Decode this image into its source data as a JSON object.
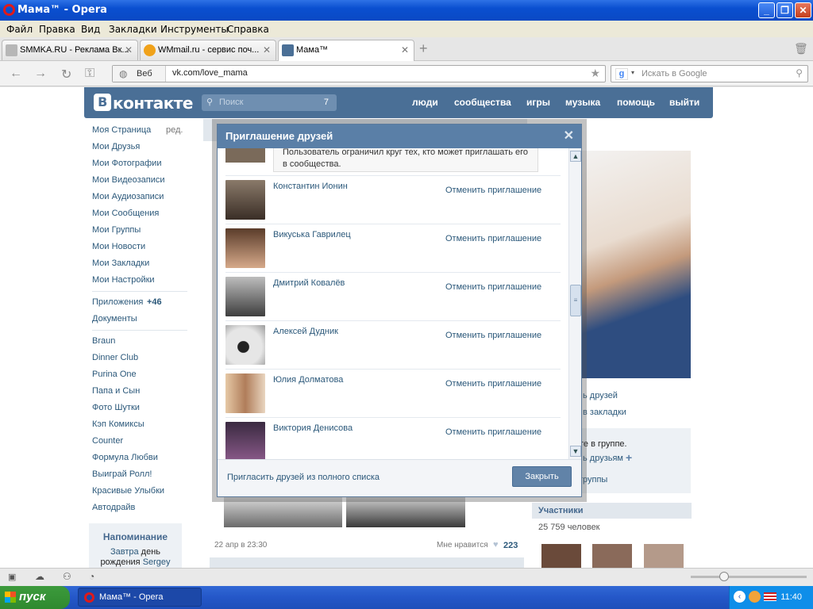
{
  "window": {
    "title": "Мама™ - Opera"
  },
  "menu": [
    "Файл",
    "Правка",
    "Вид",
    "Закладки",
    "Инструменты",
    "Справка"
  ],
  "tabs": [
    {
      "label": "SMMKA.RU - Реклама Вк...",
      "favicon_color": "#b7b7b7"
    },
    {
      "label": "WMmail.ru - сервис поч...",
      "favicon_color": "#f0a21a"
    },
    {
      "label": "Мама™",
      "favicon_color": "#4a6f96"
    }
  ],
  "address": {
    "mode": "Веб",
    "url": "vk.com/love_mama"
  },
  "search": {
    "placeholder": "Искать в Google"
  },
  "vk": {
    "logo": "контакте",
    "search_placeholder": "Поиск",
    "search_count": "7",
    "nav": [
      "люди",
      "сообщества",
      "игры",
      "музыка",
      "помощь",
      "выйти"
    ],
    "left_menu": [
      "Моя Страница",
      "Мои Друзья",
      "Мои Фотографии",
      "Мои Видеозаписи",
      "Мои Аудиозаписи",
      "Мои Сообщения",
      "Мои Группы",
      "Мои Новости",
      "Мои Закладки",
      "Мои Настройки"
    ],
    "edit_label": "ред.",
    "apps": "Приложения",
    "apps_count": "+46",
    "docs": "Документы",
    "app_links": [
      "Braun",
      "Dinner Club",
      "Purina One",
      "Папа и Сын",
      "Фото Шутки",
      "Кэп Комиксы",
      "Counter",
      "Формула Любви",
      "Выиграй Ролл!",
      "Красивые Улыбки",
      "Автодрайв"
    ],
    "reminder_title": "Напоминание",
    "reminder_text_pre": "Завтра",
    "reminder_text_day": "день",
    "reminder_text_post": "рождения",
    "reminder_name": "Sergey",
    "post_date": "22 апр в 23:30",
    "likes_label": "Мне нравится",
    "likes_count": "223",
    "right_links": [
      "ь друзей",
      "в закладки"
    ],
    "right_box_text": "те в группе.",
    "right_box_link": "ь друзьям",
    "right_box_groups": "группы",
    "members_title": "Участники",
    "members_count": "25 759 человек"
  },
  "modal": {
    "title": "Приглашение друзей",
    "notice": "Пользователь ограничил круг тех, кто может приглашать его в сообщества.",
    "cancel_label": "Отменить приглашение",
    "friends": [
      {
        "name": "Константин Ионин",
        "avatar_color": "#5b4a3e"
      },
      {
        "name": "Викуська Гаврилец",
        "avatar_color": "#b08058"
      },
      {
        "name": "Дмитрий Ковалёв",
        "avatar_color": "#6a6a6a"
      },
      {
        "name": "Алексей Дудник",
        "avatar_color": "#9a9a9a"
      },
      {
        "name": "Юлия Долматова",
        "avatar_color": "#c09a7a"
      },
      {
        "name": "Виктория Денисова",
        "avatar_color": "#4a3a52"
      }
    ],
    "invite_all": "Пригласить друзей из полного списка",
    "close_btn": "Закрыть"
  },
  "taskbar": {
    "start": "пуск",
    "task": "Мама™ - Opera",
    "clock": "11:40"
  }
}
